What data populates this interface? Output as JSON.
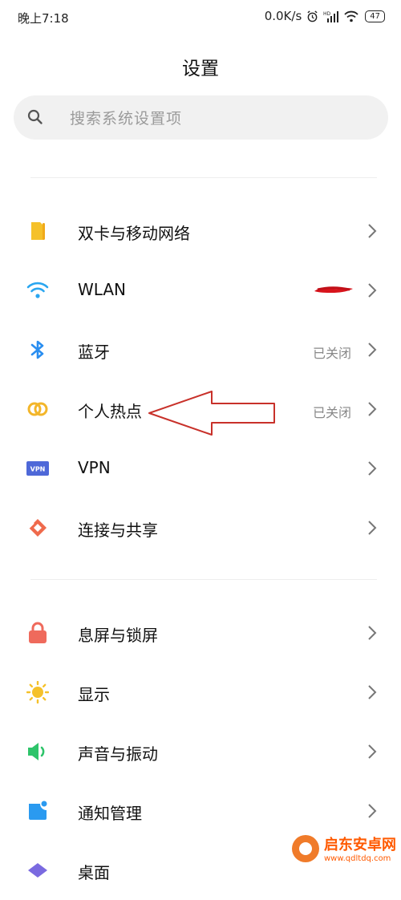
{
  "status_bar": {
    "time": "晚上7:18",
    "speed": "0.0K/s",
    "battery": "47",
    "signal_label": "HD"
  },
  "page": {
    "title": "设置"
  },
  "search": {
    "placeholder": "搜索系统设置项"
  },
  "group1": [
    {
      "label": "双卡与移动网络",
      "status": "",
      "icon": "sim-card-icon"
    },
    {
      "label": "WLAN",
      "status": "",
      "icon": "wifi-icon"
    },
    {
      "label": "蓝牙",
      "status": "已关闭",
      "icon": "bluetooth-icon"
    },
    {
      "label": "个人热点",
      "status": "已关闭",
      "icon": "hotspot-icon"
    },
    {
      "label": "VPN",
      "status": "",
      "icon": "vpn-icon"
    },
    {
      "label": "连接与共享",
      "status": "",
      "icon": "share-icon"
    }
  ],
  "group2": [
    {
      "label": "息屏与锁屏",
      "status": "",
      "icon": "lock-icon"
    },
    {
      "label": "显示",
      "status": "",
      "icon": "sun-icon"
    },
    {
      "label": "声音与振动",
      "status": "",
      "icon": "speaker-icon"
    },
    {
      "label": "通知管理",
      "status": "",
      "icon": "notification-icon"
    },
    {
      "label": "桌面",
      "status": "",
      "icon": "desktop-icon"
    }
  ],
  "vpn_badge": "VPN",
  "watermark": {
    "name": "启东安卓网",
    "url": "www.qdltdq.com"
  },
  "colors": {
    "sim": "#f5c12a",
    "wifi": "#2aa6f0",
    "bluetooth": "#2a8ef0",
    "hotspot": "#f3b62a",
    "vpn": "#4e68d8",
    "share": "#ef6a4c",
    "lock": "#ef6a5c",
    "sun": "#f5c12a",
    "speaker": "#2ec46a",
    "notification": "#2a9af0",
    "annotation": "#c8312a"
  }
}
